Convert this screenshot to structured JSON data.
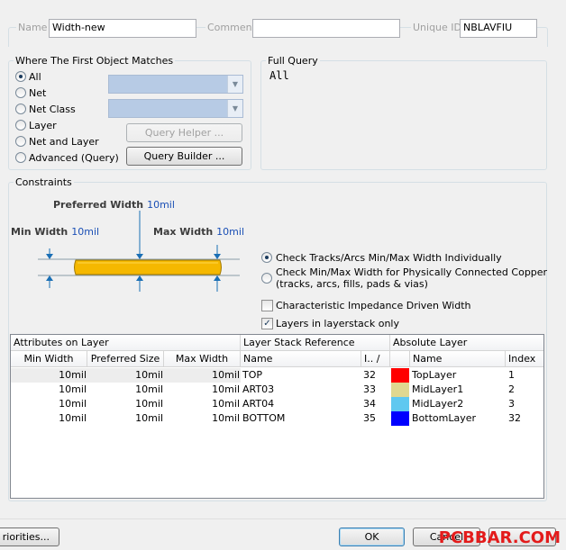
{
  "header": {
    "name_label": "Name",
    "name_value": "Width-new",
    "comment_label": "Comment",
    "comment_value": "",
    "uid_label": "Unique ID",
    "uid_value": "NBLAVFIU"
  },
  "match": {
    "group_label": "Where The First Object Matches",
    "options": [
      "All",
      "Net",
      "Net Class",
      "Layer",
      "Net and Layer",
      "Advanced (Query)"
    ],
    "selected": "All",
    "query_helper_label": "Query Helper ...",
    "query_builder_label": "Query Builder ..."
  },
  "full_query": {
    "group_label": "Full Query",
    "text": "All"
  },
  "constraints": {
    "group_label": "Constraints",
    "preferred_label": "Preferred Width",
    "preferred_value": "10mil",
    "min_label": "Min Width",
    "min_value": "10mil",
    "max_label": "Max Width",
    "max_value": "10mil",
    "check_option_1": "Check Tracks/Arcs Min/Max Width Individually",
    "check_option_2a": "Check Min/Max Width for Physically Connected Copper",
    "check_option_2b": "(tracks, arcs, fills, pads & vias)",
    "check_option_selected": 1,
    "impedance_label": "Characteristic Impedance Driven Width",
    "impedance_checked": false,
    "layerstack_label": "Layers in layerstack only",
    "layerstack_checked": true
  },
  "table": {
    "group_attr": "Attributes on Layer",
    "group_stack": "Layer Stack Reference",
    "group_abs": "Absolute Layer",
    "cols": {
      "min": "Min Width",
      "pref": "Preferred Size",
      "max": "Max Width",
      "name": "Name",
      "idx": "I.. ∕",
      "abs_name": "Name",
      "abs_index": "Index"
    },
    "rows": [
      {
        "min": "10mil",
        "pref": "10mil",
        "max": "10mil",
        "name": "TOP",
        "idx": "32",
        "abs_name": "TopLayer",
        "abs_index": "1",
        "color": "#ff0000"
      },
      {
        "min": "10mil",
        "pref": "10mil",
        "max": "10mil",
        "name": "ART03",
        "idx": "33",
        "abs_name": "MidLayer1",
        "abs_index": "2",
        "color": "#e0d890"
      },
      {
        "min": "10mil",
        "pref": "10mil",
        "max": "10mil",
        "name": "ART04",
        "idx": "34",
        "abs_name": "MidLayer2",
        "abs_index": "3",
        "color": "#5fc8f0"
      },
      {
        "min": "10mil",
        "pref": "10mil",
        "max": "10mil",
        "name": "BOTTOM",
        "idx": "35",
        "abs_name": "BottomLayer",
        "abs_index": "32",
        "color": "#0000ff"
      }
    ]
  },
  "footer": {
    "priorities_label": "riorities...",
    "ok_label": "OK",
    "cancel_label": "Cancel",
    "watermark": "PCBBAR.COM"
  }
}
